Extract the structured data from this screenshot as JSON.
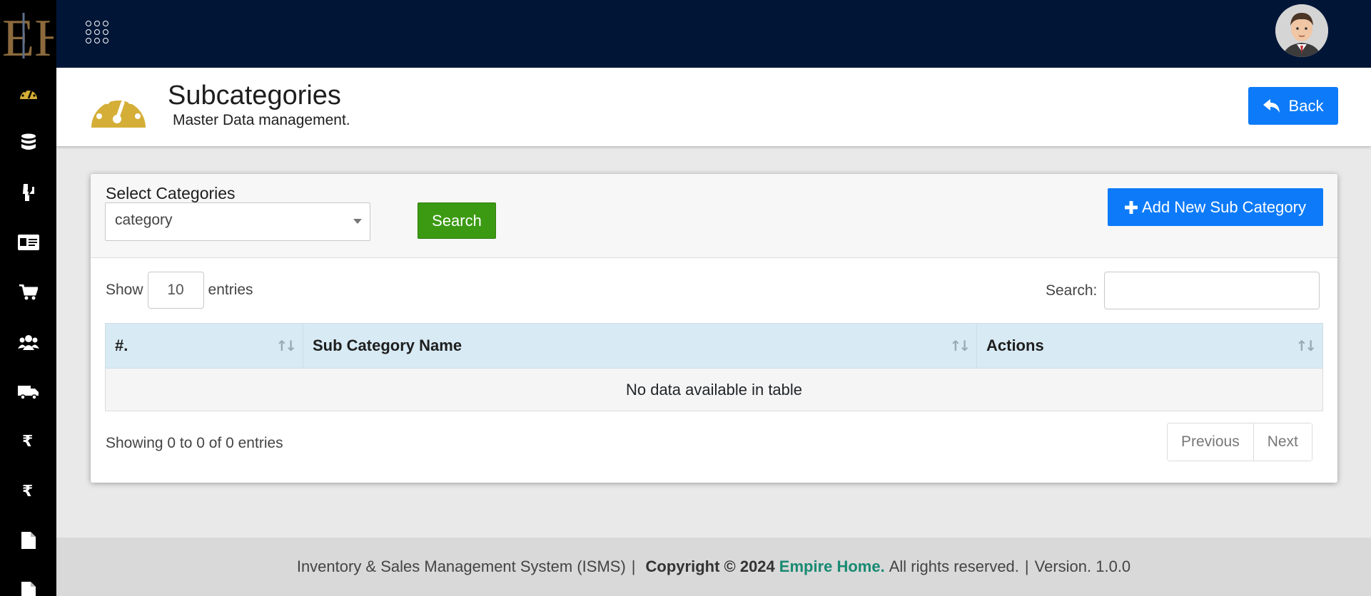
{
  "sidebar": {
    "logo_text": "EH",
    "items": [
      {
        "icon": "dashboard-icon",
        "glyph": "◔"
      },
      {
        "icon": "database-icon",
        "glyph": "⛁"
      },
      {
        "icon": "bolt-icon",
        "glyph": "↯"
      },
      {
        "icon": "id-card-icon",
        "glyph": "▤"
      },
      {
        "icon": "cart-icon",
        "glyph": "🛒"
      },
      {
        "icon": "users-icon",
        "glyph": "👥"
      },
      {
        "icon": "truck-icon",
        "glyph": "🚚"
      },
      {
        "icon": "rupee-icon",
        "glyph": "₹"
      },
      {
        "icon": "rupee-icon",
        "glyph": "₹"
      },
      {
        "icon": "file-icon",
        "glyph": "📄"
      },
      {
        "icon": "file-icon",
        "glyph": "📄"
      }
    ]
  },
  "header": {
    "title": "Subcategories",
    "subtitle": "Master Data management.",
    "back_label": "Back"
  },
  "filter": {
    "label": "Select Categories",
    "selected": "category",
    "search_label": "Search",
    "add_label": "Add New Sub Category"
  },
  "table": {
    "show_label": "Show",
    "entries_label": "entries",
    "page_length": "10",
    "search_label": "Search:",
    "columns": [
      "#.",
      "Sub Category Name",
      "Actions"
    ],
    "empty_message": "No data available in table",
    "info": "Showing 0 to 0 of 0 entries",
    "prev_label": "Previous",
    "next_label": "Next"
  },
  "footer": {
    "text1": "Inventory & Sales Management System (ISMS)",
    "sep": "|",
    "copyright": "Copyright © 2024",
    "brand": "Empire Home.",
    "text2": "All rights reserved.",
    "version": "Version. 1.0.0"
  },
  "colors": {
    "topbar": "#011637",
    "primary": "#0d7bf9",
    "success": "#3b9a12",
    "accent_gold": "#d4ae37",
    "brand_green": "#188a72"
  }
}
